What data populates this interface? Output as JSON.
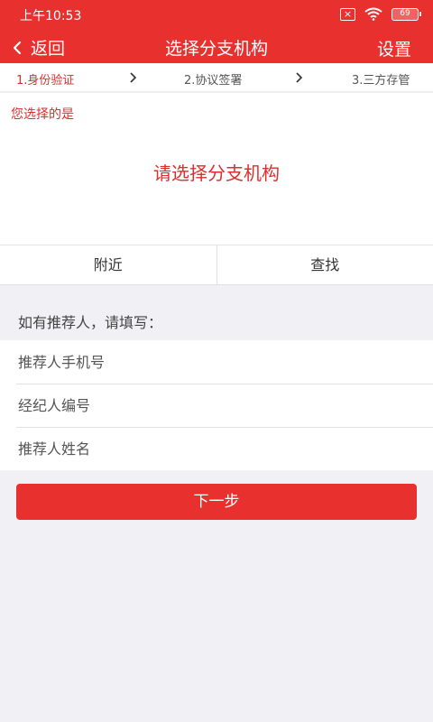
{
  "statusbar": {
    "time": "上午10:53",
    "battery": "69"
  },
  "header": {
    "back_label": "返回",
    "title": "选择分支机构",
    "settings_label": "设置"
  },
  "steps": [
    {
      "label": "1.身份验证"
    },
    {
      "label": "2.协议签署"
    },
    {
      "label": "3.三方存管"
    }
  ],
  "selection": {
    "caption": "您选择的是",
    "value": "请选择分支机构"
  },
  "tabs": [
    {
      "label": "附近"
    },
    {
      "label": "查找"
    }
  ],
  "referrer": {
    "hint": "如有推荐人，请填写：",
    "fields": [
      {
        "placeholder": "推荐人手机号",
        "value": ""
      },
      {
        "placeholder": "经纪人编号",
        "value": ""
      },
      {
        "placeholder": "推荐人姓名",
        "value": ""
      }
    ]
  },
  "next_button": "下一步",
  "colors": {
    "accent": "#e8312f",
    "background": "#f1f0f4"
  }
}
